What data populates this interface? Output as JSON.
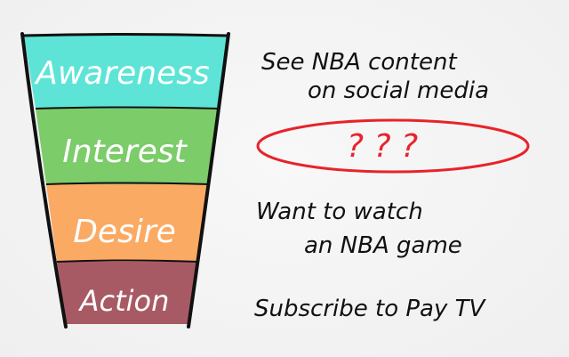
{
  "funnel": {
    "stages": [
      {
        "label": "Awareness",
        "color": "#5ee4d6"
      },
      {
        "label": "Interest",
        "color": "#7ccc6a"
      },
      {
        "label": "Desire",
        "color": "#fbaa63"
      },
      {
        "label": "Action",
        "color": "#a85a64"
      }
    ]
  },
  "notes": {
    "awareness_line1": "See NBA content",
    "awareness_line2": "on social media",
    "interest_placeholder": "? ? ?",
    "desire_line1": "Want to watch",
    "desire_line2": "an NBA game",
    "action_line1": "Subscribe to Pay TV"
  },
  "colors": {
    "outline": "#111111",
    "highlight_ellipse": "#e8232a",
    "question_marks": "#e8232a"
  }
}
